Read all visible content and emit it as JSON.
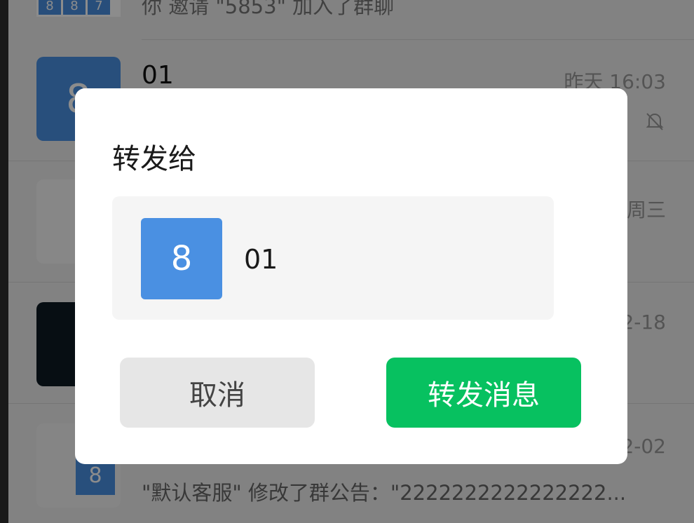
{
  "chat_list": {
    "rows": [
      {
        "title": "",
        "subtitle": "你 邀请 \"5853\" 加入了群聊",
        "time": "",
        "avatar_tiles": [
          "8",
          "8",
          "7"
        ]
      },
      {
        "title": "01",
        "subtitle": "",
        "time": "昨天 16:03",
        "avatar_text": "8",
        "muted": true
      },
      {
        "title": "",
        "subtitle": "",
        "time": "周三"
      },
      {
        "title": "",
        "subtitle": "",
        "time": "2-18"
      },
      {
        "title": "",
        "subtitle": "\"默认客服\" 修改了群公告：\"2222222222222222...",
        "time": "2-02",
        "avatar_text": "8"
      }
    ]
  },
  "dialog": {
    "title": "转发给",
    "target": {
      "avatar_text": "8",
      "name": "01"
    },
    "cancel_label": "取消",
    "confirm_label": "转发消息"
  },
  "colors": {
    "accent": "#07c160",
    "avatar_blue": "#4a90e2",
    "overlay": "rgba(0,0,0,0.45)"
  },
  "icons": [
    "bell-muted-icon"
  ]
}
